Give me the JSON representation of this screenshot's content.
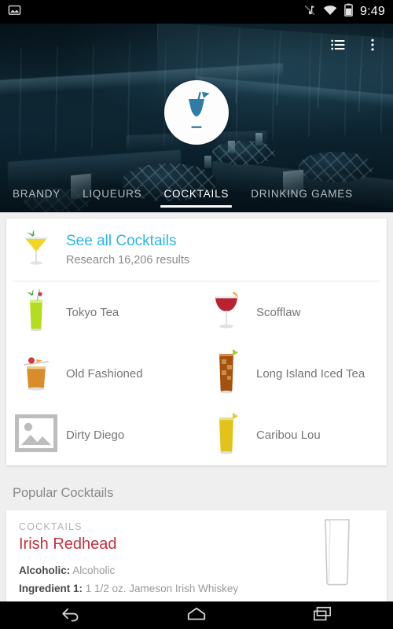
{
  "status_bar": {
    "time": "9:49",
    "icons": [
      "screenshot-icon",
      "silent-mode-icon",
      "wifi-icon",
      "battery-icon"
    ]
  },
  "hero": {
    "logo_icon": "cocktail-glass-logo",
    "actions": [
      {
        "name": "list-view-button",
        "icon": "list-icon"
      },
      {
        "name": "overflow-menu-button",
        "icon": "more-vert-icon"
      }
    ]
  },
  "tabs": [
    {
      "label": "BRANDY",
      "active": false
    },
    {
      "label": "LIQUEURS",
      "active": false
    },
    {
      "label": "COCKTAILS",
      "active": true
    },
    {
      "label": "DRINKING GAMES",
      "active": false
    }
  ],
  "see_all": {
    "title": "See all Cocktails",
    "subtitle": "Research 16,206 results",
    "icon": "yellow-martini-icon"
  },
  "items": [
    {
      "label": "Tokyo Tea",
      "icon": "green-highball-icon"
    },
    {
      "label": "Scofflaw",
      "icon": "red-coupe-icon"
    },
    {
      "label": "Old Fashioned",
      "icon": "amber-rocks-icon"
    },
    {
      "label": "Long Island Iced Tea",
      "icon": "cola-highball-icon"
    },
    {
      "label": "Dirty Diego",
      "icon": "image-placeholder-icon"
    },
    {
      "label": "Caribou Lou",
      "icon": "yellow-highball-icon"
    }
  ],
  "popular": {
    "section_title": "Popular Cocktails",
    "card": {
      "category": "COCKTAILS",
      "name": "Irish Redhead",
      "fields": [
        {
          "label": "Alcoholic:",
          "value": " Alcoholic"
        },
        {
          "label": "Ingredient 1:",
          "value": " 1 1/2 oz. Jameson Irish Whiskey"
        }
      ],
      "image": "empty-highball-glass"
    }
  },
  "nav_bar": {
    "buttons": [
      {
        "name": "back-button",
        "icon": "back-arrow-icon"
      },
      {
        "name": "home-button",
        "icon": "home-icon"
      },
      {
        "name": "recents-button",
        "icon": "recents-icon"
      }
    ]
  },
  "colors": {
    "accent_cyan": "#29b6e5",
    "title_red": "#c2323e",
    "page_bg": "#efefef",
    "hero_dark": "#0c1c24"
  }
}
